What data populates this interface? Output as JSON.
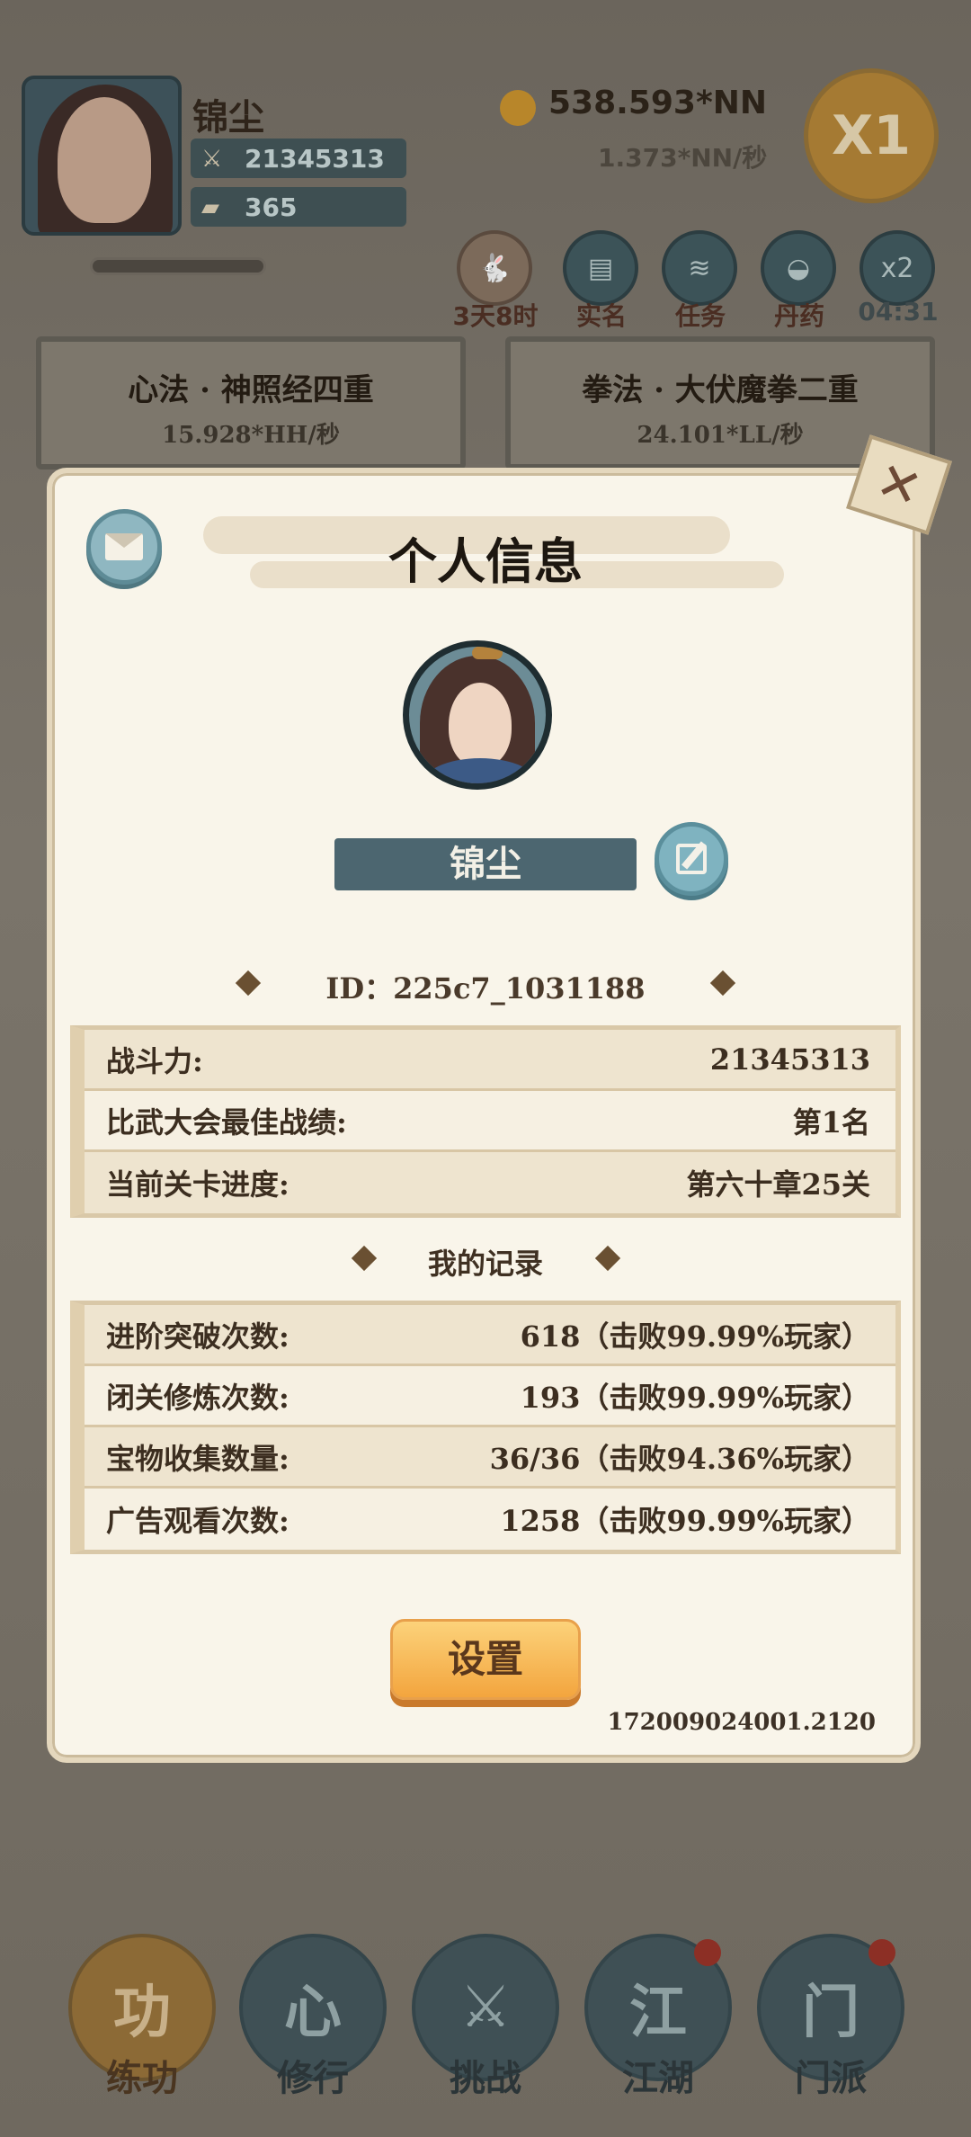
{
  "hud": {
    "player_name": "锦尘",
    "combat_power": "21345313",
    "gold_ingots": "365",
    "currency": "538.593*NN",
    "currency_rate": "1.373*NN/秒",
    "multiplier": "X1",
    "event_timer": "3天8时",
    "icons": [
      {
        "label": "实名",
        "icon": "id-card-icon"
      },
      {
        "label": "任务",
        "icon": "scroll-icon"
      },
      {
        "label": "丹药",
        "icon": "cauldron-icon"
      },
      {
        "label": "04:31",
        "icon": "x2-icon",
        "icon_text": "x2"
      }
    ]
  },
  "skills": [
    {
      "title": "心法 · 神照经四重",
      "rate": "15.928*HH/秒"
    },
    {
      "title": "拳法 · 大伏魔拳二重",
      "rate": "24.101*LL/秒"
    }
  ],
  "modal": {
    "title": "个人信息",
    "name": "锦尘",
    "id_text": "ID：225c7_1031188",
    "stats": [
      {
        "label": "战斗力:",
        "value": "21345313"
      },
      {
        "label": "比武大会最佳战绩:",
        "value": "第1名"
      },
      {
        "label": "当前关卡进度:",
        "value": "第六十章25关"
      }
    ],
    "records_title": "我的记录",
    "records": [
      {
        "label": "进阶突破次数:",
        "value": "618（击败99.99%玩家）"
      },
      {
        "label": "闭关修炼次数:",
        "value": "193（击败99.99%玩家）"
      },
      {
        "label": "宝物收集数量:",
        "value": "36/36（击败94.36%玩家）"
      },
      {
        "label": "广告观看次数:",
        "value": "1258（击败99.99%玩家）"
      }
    ],
    "settings_label": "设置",
    "version": "172009024001.2120",
    "close_glyph": "✕"
  },
  "bottom_nav": [
    {
      "label": "练功",
      "glyph": "功",
      "active": true,
      "badge": false
    },
    {
      "label": "修行",
      "glyph": "心",
      "active": false,
      "badge": false
    },
    {
      "label": "挑战",
      "glyph": "⚔",
      "active": false,
      "badge": false
    },
    {
      "label": "江湖",
      "glyph": "江",
      "active": false,
      "badge": true
    },
    {
      "label": "门派",
      "glyph": "门",
      "active": false,
      "badge": true
    }
  ],
  "colors": {
    "accent_orange": "#f3a53e",
    "slate_blue": "#4c6670",
    "parchment": "#f9f5ea"
  }
}
